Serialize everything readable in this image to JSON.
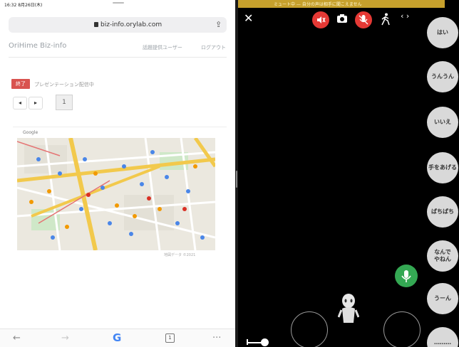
{
  "status_bar": {
    "time_date": "16:32 8月26日(木)"
  },
  "browser": {
    "url": "biz-info.orylab.com",
    "site_title": "OriHime Biz-info",
    "nav_links": [
      "話題提供ユーザー",
      "ログアウト"
    ],
    "end_button": "終了",
    "presenting_text": "プレゼンテーション配信中",
    "prev_label": "◂",
    "next_label": "▸",
    "page_number": "1",
    "slide_label": "Google",
    "map_credit": "地図データ ©2021",
    "bottom": {
      "back": "←",
      "forward": "→",
      "google": "G",
      "tabs": "1",
      "more": "···"
    }
  },
  "avatar_app": {
    "banner": "ミュート中 — 自分の声は相手に聞こえません",
    "close": "✕",
    "toolbar_icons": [
      "speaker-muted-icon",
      "camera-icon",
      "mic-muted-icon",
      "walk-icon",
      "code-brackets-icon"
    ],
    "code_label": "‹ ›",
    "side_buttons": [
      "はい",
      "うんうん",
      "いいえ",
      "手をあげる",
      "ぱちぱち",
      "なんで\nやねん",
      "うーん",
      "………"
    ],
    "colors": {
      "banner": "#c6a02c",
      "red": "#e53935",
      "green": "#34a853",
      "button": "#d9d9d9"
    }
  }
}
